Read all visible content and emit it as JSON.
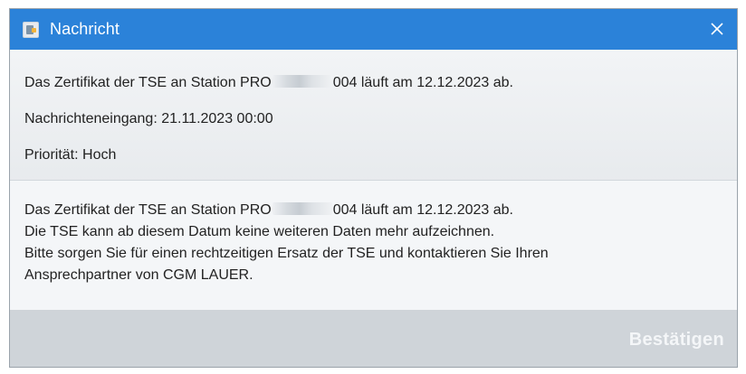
{
  "window": {
    "title": "Nachricht",
    "accent_color": "#2b82d9",
    "app_icon": "app-icon",
    "close_icon": "close-icon"
  },
  "info": {
    "certificate_prefix": "Das Zertifikat der TSE an Station PRO",
    "certificate_suffix": "004 läuft am 12.12.2023 ab.",
    "received": "Nachrichteneingang: 21.11.2023 00:00",
    "priority": "Priorität: Hoch"
  },
  "message": {
    "line1_prefix": "Das Zertifikat der TSE an Station PRO",
    "line1_suffix": "004 läuft am 12.12.2023 ab.",
    "line2": "Die TSE kann ab diesem Datum keine weiteren Daten mehr aufzeichnen.",
    "line3": "Bitte sorgen Sie für einen rechtzeitigen Ersatz der TSE und kontaktieren Sie Ihren",
    "line4": "Ansprechpartner von CGM LAUER."
  },
  "footer": {
    "confirm_label": "Bestätigen"
  }
}
